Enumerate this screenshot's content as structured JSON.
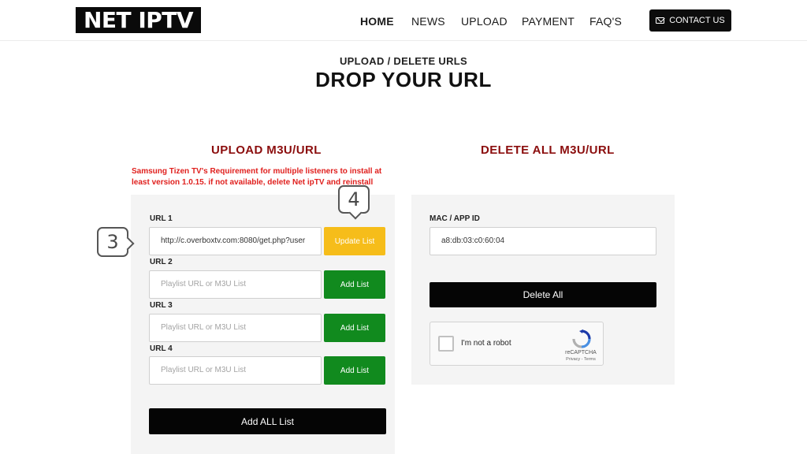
{
  "header": {
    "logo": "NET IPTV",
    "nav": [
      {
        "label": "HOME",
        "active": true
      },
      {
        "label": "NEWS",
        "active": false
      },
      {
        "label": "UPLOAD",
        "active": false
      },
      {
        "label": "PAYMENT",
        "active": false
      },
      {
        "label": "FAQ'S",
        "active": false
      }
    ],
    "contact": {
      "label": "CONTACT US",
      "icon": "mail-icon"
    }
  },
  "page": {
    "subtitle": "UPLOAD / DELETE URLS",
    "title": "DROP YOUR URL"
  },
  "upload": {
    "heading": "UPLOAD M3U/URL",
    "warning": "Samsung Tizen TV's Requirement for multiple listeners to install at least version 1.0.15. if not available, delete Net ipTV and reinstall",
    "urls": [
      {
        "label": "URL 1",
        "value": "http://c.overboxtv.com:8080/get.php?user",
        "placeholder": "",
        "button": "Update List"
      },
      {
        "label": "URL 2",
        "value": "",
        "placeholder": "Playlist URL or M3U List",
        "button": "Add List"
      },
      {
        "label": "URL 3",
        "value": "",
        "placeholder": "Playlist URL or M3U List",
        "button": "Add List"
      },
      {
        "label": "URL 4",
        "value": "",
        "placeholder": "Playlist URL or M3U List",
        "button": "Add List"
      }
    ],
    "add_all_label": "Add ALL List"
  },
  "delete": {
    "heading": "DELETE ALL M3U/URL",
    "mac_label": "MAC / APP ID",
    "mac_value": "a8:db:03:c0:60:04",
    "delete_all_label": "Delete All",
    "captcha": {
      "label": "I'm not a robot",
      "brand": "reCAPTCHA",
      "terms": "Privacy - Terms"
    }
  },
  "callouts": {
    "c3": "3",
    "c4": "4"
  },
  "colors": {
    "heading_red": "#8b0d0d",
    "warning_red": "#e0201e",
    "add_green": "#118a1e",
    "update_yellow": "#f6bd1a",
    "button_black": "#050505"
  }
}
